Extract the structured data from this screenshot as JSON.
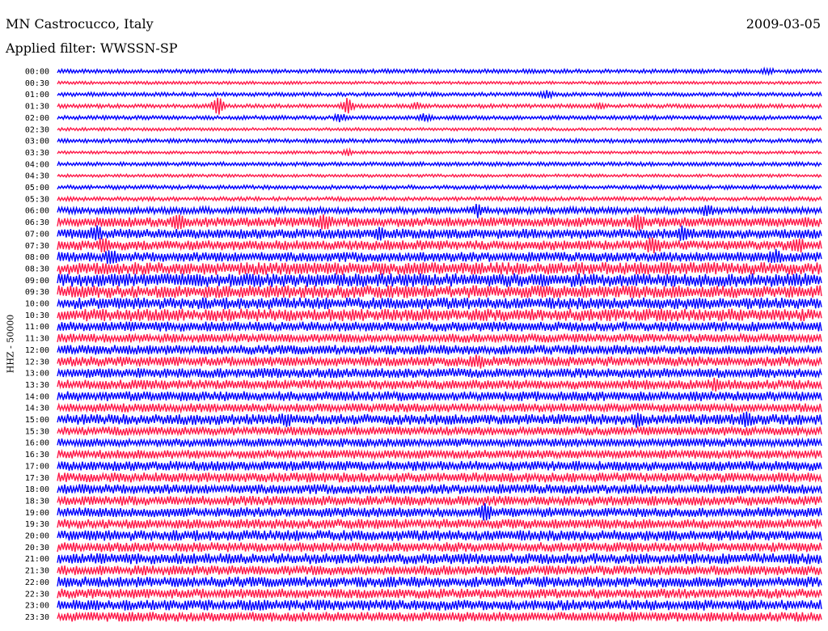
{
  "header": {
    "station": "MN Castrocucco, Italy",
    "date": "2009-03-05",
    "filter": "Applied filter: WWSSN-SP"
  },
  "chart_data": {
    "type": "line",
    "title": "MN Castrocucco, Italy",
    "ylabel": "HHZ - 50000",
    "xlabel": "",
    "colors": [
      "#0000ff",
      "#ff1a4a"
    ],
    "rows": [
      {
        "label": "00:00",
        "amplitude": 2,
        "events": [
          [
            0.93,
            3
          ]
        ]
      },
      {
        "label": "00:30",
        "amplitude": 1.5,
        "events": []
      },
      {
        "label": "01:00",
        "amplitude": 2,
        "events": [
          [
            0.64,
            4
          ]
        ]
      },
      {
        "label": "01:30",
        "amplitude": 2,
        "events": [
          [
            0.21,
            12
          ],
          [
            0.38,
            9
          ],
          [
            0.47,
            3
          ],
          [
            0.71,
            3
          ]
        ]
      },
      {
        "label": "02:00",
        "amplitude": 2,
        "events": [
          [
            0.37,
            4
          ],
          [
            0.48,
            4
          ]
        ]
      },
      {
        "label": "02:30",
        "amplitude": 1.5,
        "events": []
      },
      {
        "label": "03:00",
        "amplitude": 2,
        "events": []
      },
      {
        "label": "03:30",
        "amplitude": 1.5,
        "events": [
          [
            0.38,
            3
          ]
        ]
      },
      {
        "label": "04:00",
        "amplitude": 2,
        "events": []
      },
      {
        "label": "04:30",
        "amplitude": 1.5,
        "events": []
      },
      {
        "label": "05:00",
        "amplitude": 2,
        "events": []
      },
      {
        "label": "05:30",
        "amplitude": 2,
        "events": []
      },
      {
        "label": "06:00",
        "amplitude": 3.5,
        "events": [
          [
            0.55,
            6
          ],
          [
            0.85,
            6
          ]
        ]
      },
      {
        "label": "06:30",
        "amplitude": 5,
        "events": [
          [
            0.16,
            8
          ],
          [
            0.35,
            7
          ],
          [
            0.76,
            8
          ]
        ]
      },
      {
        "label": "07:00",
        "amplitude": 5,
        "events": [
          [
            0.05,
            6
          ],
          [
            0.42,
            5
          ],
          [
            0.82,
            6
          ]
        ]
      },
      {
        "label": "07:30",
        "amplitude": 5,
        "events": [
          [
            0.06,
            6
          ],
          [
            0.78,
            9
          ],
          [
            0.97,
            7
          ]
        ]
      },
      {
        "label": "08:00",
        "amplitude": 5,
        "events": [
          [
            0.07,
            6
          ],
          [
            0.94,
            6
          ]
        ]
      },
      {
        "label": "08:30",
        "amplitude": 6.5,
        "events": []
      },
      {
        "label": "09:00",
        "amplitude": 7,
        "events": []
      },
      {
        "label": "09:30",
        "amplitude": 6.5,
        "events": []
      },
      {
        "label": "10:00",
        "amplitude": 6,
        "events": []
      },
      {
        "label": "10:30",
        "amplitude": 6.5,
        "events": []
      },
      {
        "label": "11:00",
        "amplitude": 5,
        "events": []
      },
      {
        "label": "11:30",
        "amplitude": 4.5,
        "events": []
      },
      {
        "label": "12:00",
        "amplitude": 5,
        "events": []
      },
      {
        "label": "12:30",
        "amplitude": 5,
        "events": [
          [
            0.55,
            5
          ]
        ]
      },
      {
        "label": "13:00",
        "amplitude": 5,
        "events": []
      },
      {
        "label": "13:30",
        "amplitude": 5,
        "events": [
          [
            0.86,
            4
          ]
        ]
      },
      {
        "label": "14:00",
        "amplitude": 5,
        "events": []
      },
      {
        "label": "14:30",
        "amplitude": 4.5,
        "events": []
      },
      {
        "label": "15:00",
        "amplitude": 5.5,
        "events": [
          [
            0.3,
            5
          ],
          [
            0.76,
            5
          ],
          [
            0.9,
            6
          ]
        ]
      },
      {
        "label": "15:30",
        "amplitude": 4.5,
        "events": []
      },
      {
        "label": "16:00",
        "amplitude": 4.5,
        "events": []
      },
      {
        "label": "16:30",
        "amplitude": 4.5,
        "events": []
      },
      {
        "label": "17:00",
        "amplitude": 5,
        "events": []
      },
      {
        "label": "17:30",
        "amplitude": 5,
        "events": []
      },
      {
        "label": "18:00",
        "amplitude": 5,
        "events": []
      },
      {
        "label": "18:30",
        "amplitude": 5,
        "events": []
      },
      {
        "label": "19:00",
        "amplitude": 5,
        "events": [
          [
            0.56,
            8
          ]
        ]
      },
      {
        "label": "19:30",
        "amplitude": 5,
        "events": []
      },
      {
        "label": "20:00",
        "amplitude": 5.5,
        "events": []
      },
      {
        "label": "20:30",
        "amplitude": 5,
        "events": []
      },
      {
        "label": "21:00",
        "amplitude": 5.5,
        "events": []
      },
      {
        "label": "21:30",
        "amplitude": 5,
        "events": []
      },
      {
        "label": "22:00",
        "amplitude": 5.5,
        "events": []
      },
      {
        "label": "22:30",
        "amplitude": 5,
        "events": []
      },
      {
        "label": "23:00",
        "amplitude": 5.5,
        "events": []
      },
      {
        "label": "23:30",
        "amplitude": 5,
        "events": []
      }
    ]
  }
}
